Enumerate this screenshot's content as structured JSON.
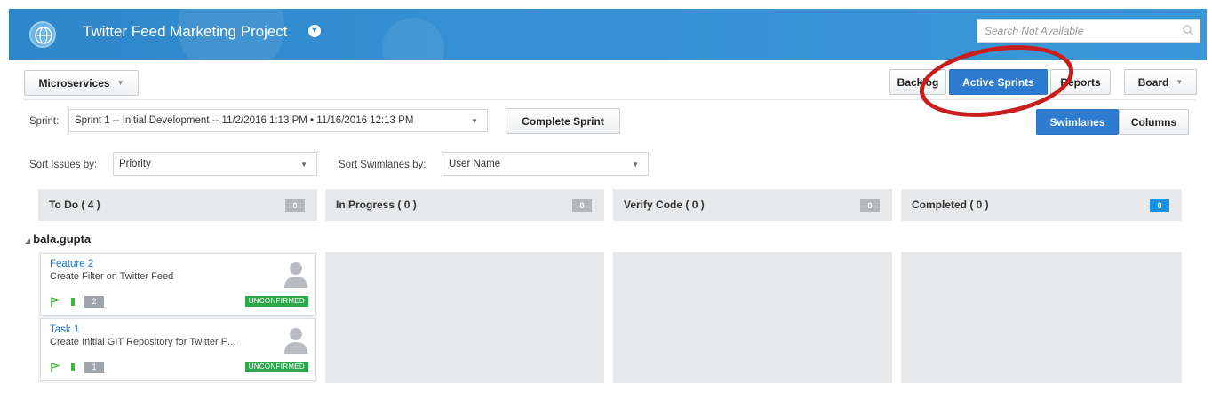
{
  "header": {
    "title": "Twitter Feed Marketing Project",
    "logo_icon": "globe-icon",
    "title_icon": "chevron-down-circle-icon",
    "search_placeholder": "Search Not Available",
    "search_icon": "search-icon",
    "bg_color": "#3591d3"
  },
  "toolbar": {
    "project_dropdown": "Microservices",
    "nav_buttons": [
      {
        "label": "Backlog",
        "active": false
      },
      {
        "label": "Active Sprints",
        "active": true
      },
      {
        "label": "Reports",
        "active": false
      }
    ],
    "board_button": "Board",
    "accent_color": "#2d7cd0"
  },
  "sprint": {
    "label": "Sprint:",
    "value": "Sprint 1 -- Initial Development -- 11/2/2016 1:13 PM • 11/16/2016 12:13 PM",
    "complete_button": "Complete Sprint"
  },
  "view_toggle": {
    "swimlanes": "Swimlanes",
    "columns": "Columns",
    "active": "Swimlanes"
  },
  "sorting": {
    "issues_label": "Sort Issues by:",
    "issues_value": "Priority",
    "swimlanes_label": "Sort Swimlanes by:",
    "swimlanes_value": "User Name"
  },
  "columns": [
    {
      "title": "To Do ( 4 )",
      "count": "0"
    },
    {
      "title": "In Progress ( 0 )",
      "count": "0"
    },
    {
      "title": "Verify Code ( 0 )",
      "count": "0"
    },
    {
      "title": "Completed ( 0 )",
      "count": "0"
    }
  ],
  "swimlane": {
    "user": "bala.gupta"
  },
  "cards": [
    {
      "title": "Feature 2",
      "description": "Create Filter on Twitter Feed",
      "points": "2",
      "status": "UNCONFIRMED"
    },
    {
      "title": "Task 1",
      "description": "Create Initial GIT Repository for Twitter F…",
      "points": "1",
      "status": "UNCONFIRMED"
    }
  ],
  "annotation": {
    "color": "#c81e1e"
  }
}
